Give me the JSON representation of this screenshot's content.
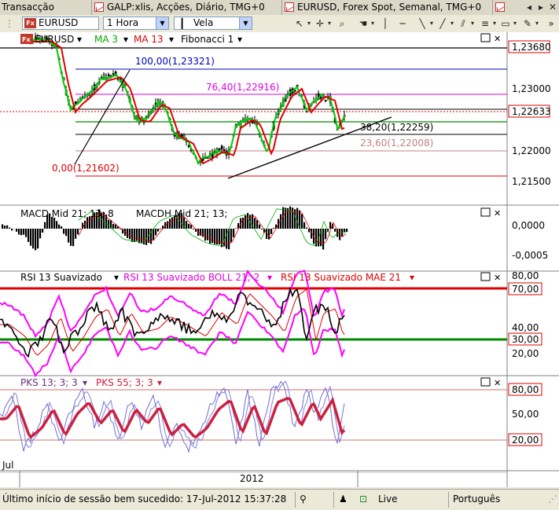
{
  "tabs": [
    {
      "label": "Transacção"
    },
    {
      "label": "GALP:xlis, Acções, Diário, TMG+0"
    },
    {
      "label": "EURUSD, Forex Spot, Semanal, TMG+0"
    }
  ],
  "toolbar": {
    "symbol": "EURUSD",
    "symbol_icon": "Fx",
    "interval": "1 Hora",
    "chart_type": "Vela"
  },
  "colors": {
    "up_candle": "#22cc22",
    "down_candle": "#000000",
    "ma3": "#00cc00",
    "ma13": "#e00000",
    "fibo_top": "#0000c0",
    "fibo_76": "#e000e0",
    "fibo_38": "#000000",
    "fibo_23": "#c08080",
    "fibo_0": "#e00000",
    "rsi": "#000000",
    "boll": "#ff00ff",
    "mae": "#e00000",
    "pks13": "#7070d0",
    "pks55": "#cc2040"
  },
  "main_panel": {
    "symbol_label": "EURUSD",
    "legend": [
      {
        "text": "MA 3",
        "color": "#00aa00"
      },
      {
        "text": "MA 13",
        "color": "#e00000"
      },
      {
        "text": "Fibonacci 1",
        "color": "#000000"
      }
    ],
    "price_ticks": [
      "1,23680",
      "1,23000",
      "1,22633",
      "1,22000",
      "1,21500"
    ],
    "current_price": "1,22633",
    "fibo_labels": {
      "l100": "100,00(1,23321)",
      "l76": "76,40(1,22916)",
      "l38": "38,20(1,22259)",
      "l23": "23,60(1,22008)",
      "l0": "0,00(1,21602)"
    }
  },
  "macd_panel": {
    "legend": [
      {
        "text": "MACD Mid  21; 13; 8",
        "color": "#000000"
      },
      {
        "text": "MACDH Mid  21; 13;",
        "color": "#000000"
      }
    ],
    "ticks": [
      "0,0000",
      "-0,0005"
    ]
  },
  "rsi_panel": {
    "legend": [
      {
        "text": "RSI 13 Suavizado",
        "color": "#000000"
      },
      {
        "text": "RSI 13 Suavizado BOLL 21; 2",
        "color": "#e000e0"
      },
      {
        "text": "RSI 13 Suavizado MAE 21",
        "color": "#e00000"
      }
    ],
    "ticks": [
      "80,00",
      "70,00",
      "40,00",
      "30,00",
      "20,00"
    ]
  },
  "pks_panel": {
    "legend": [
      {
        "text": "PKS 13; 3; 3",
        "color": "#6a3080"
      },
      {
        "text": "PKS 55; 3; 3",
        "color": "#cc2040"
      }
    ],
    "ticks": [
      "80,00",
      "50,00",
      "20,00"
    ]
  },
  "time_axis": {
    "labels": [
      "Jul",
      "2012"
    ]
  },
  "statusbar": {
    "message": "Último início de sessão bem sucedido: 17-Jul-2012 15:37:28",
    "mode": "Live",
    "language": "Português"
  }
}
